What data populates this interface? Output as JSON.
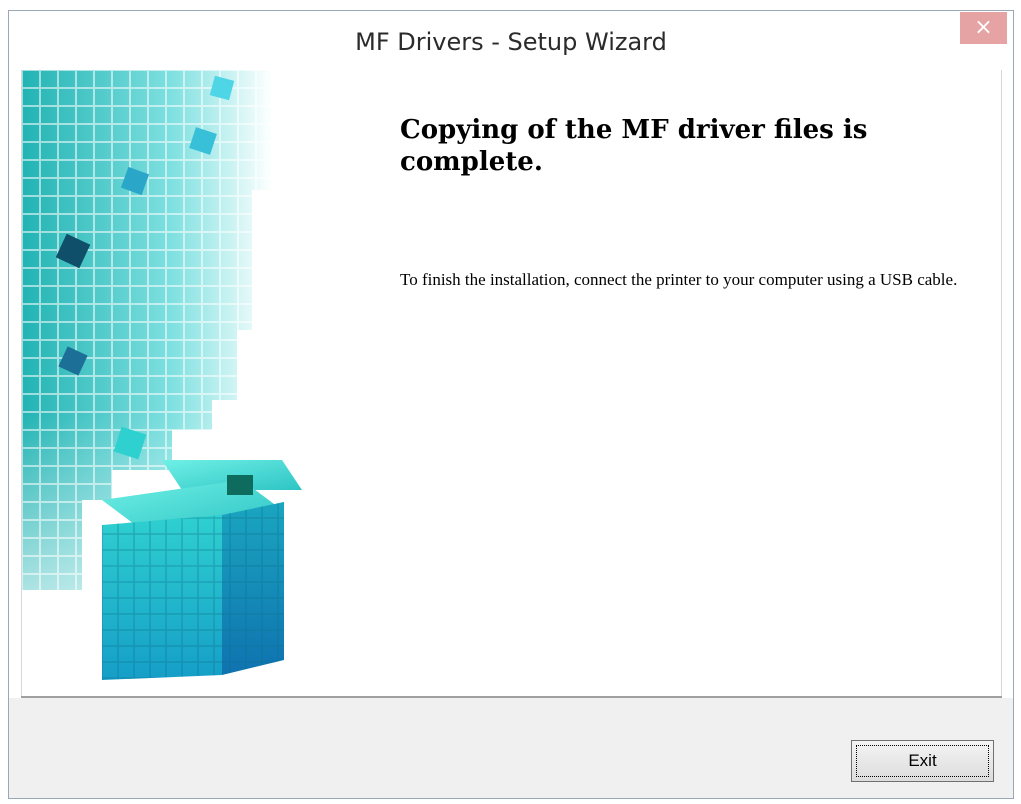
{
  "window": {
    "title": "MF Drivers - Setup Wizard",
    "close_symbol": "×"
  },
  "content": {
    "heading": "Copying of the MF driver files is complete.",
    "description": "To finish the installation, connect the printer to your computer using a USB cable."
  },
  "footer": {
    "exit_label": "Exit"
  },
  "icons": {
    "close": "close-icon",
    "art": "cube-art"
  },
  "colors": {
    "close_bg": "#e6a3a3",
    "cube_teal": "#35c9c9",
    "footer_bg": "#f0f0f0"
  }
}
